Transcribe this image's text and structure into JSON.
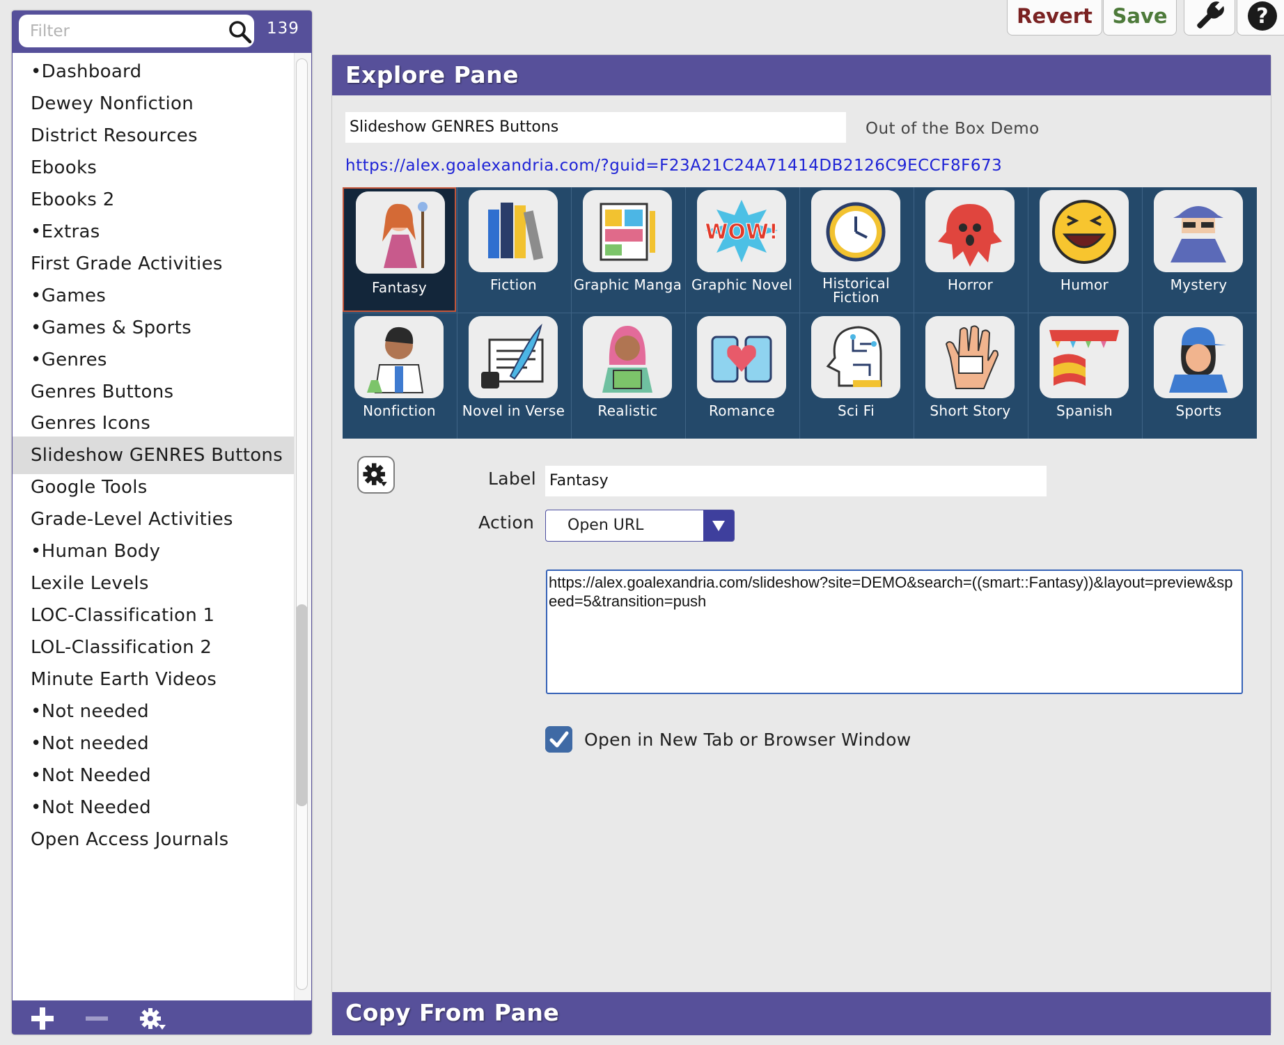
{
  "sidebar": {
    "filter_placeholder": "Filter",
    "count": "139",
    "items": [
      {
        "label": "•Dashboard"
      },
      {
        "label": "Dewey Nonfiction"
      },
      {
        "label": "District Resources"
      },
      {
        "label": "Ebooks"
      },
      {
        "label": "Ebooks 2"
      },
      {
        "label": "•Extras"
      },
      {
        "label": "First Grade Activities"
      },
      {
        "label": "•Games"
      },
      {
        "label": "•Games & Sports"
      },
      {
        "label": "•Genres"
      },
      {
        "label": "Genres Buttons"
      },
      {
        "label": "Genres Icons"
      },
      {
        "label": "Slideshow GENRES Buttons",
        "selected": true
      },
      {
        "label": "Google Tools"
      },
      {
        "label": "Grade-Level Activities"
      },
      {
        "label": "•Human Body"
      },
      {
        "label": "Lexile Levels"
      },
      {
        "label": "LOC-Classification 1"
      },
      {
        "label": "LOL-Classification 2"
      },
      {
        "label": "Minute Earth Videos"
      },
      {
        "label": "•Not needed"
      },
      {
        "label": "•Not needed"
      },
      {
        "label": "•Not Needed"
      },
      {
        "label": "•Not Needed"
      },
      {
        "label": "Open Access Journals"
      }
    ],
    "footer_icons": [
      "plus-icon",
      "minus-icon",
      "gear-menu-icon"
    ]
  },
  "toolbar": {
    "revert_label": "Revert",
    "save_label": "Save",
    "revert_color": "#7a2222",
    "save_color": "#4d7a3a",
    "tools_icon": "wrench-icon",
    "help_icon": "question-icon"
  },
  "explore": {
    "title": "Explore Pane",
    "pane_name": "Slideshow GENRES Buttons",
    "site": "Out of the Box Demo",
    "url": "https://alex.goalexandria.com/?guid=F23A21C24A71414DB2126C9ECCF8F673",
    "genres": [
      {
        "label": "Fantasy",
        "icon": "fantasy-icon",
        "selected": true
      },
      {
        "label": "Fiction",
        "icon": "fiction-icon"
      },
      {
        "label": "Graphic Manga",
        "icon": "graphic-manga-icon"
      },
      {
        "label": "Graphic Novel",
        "icon": "graphic-novel-icon"
      },
      {
        "label": "Historical Fiction",
        "icon": "historical-fiction-icon"
      },
      {
        "label": "Horror",
        "icon": "horror-icon"
      },
      {
        "label": "Humor",
        "icon": "humor-icon"
      },
      {
        "label": "Mystery",
        "icon": "mystery-icon"
      },
      {
        "label": "Nonfiction",
        "icon": "nonfiction-icon"
      },
      {
        "label": "Novel in Verse",
        "icon": "novel-in-verse-icon"
      },
      {
        "label": "Realistic",
        "icon": "realistic-icon"
      },
      {
        "label": "Romance",
        "icon": "romance-icon"
      },
      {
        "label": "Sci Fi",
        "icon": "sci-fi-icon"
      },
      {
        "label": "Short Story",
        "icon": "short-story-icon"
      },
      {
        "label": "Spanish",
        "icon": "spanish-icon"
      },
      {
        "label": "Sports",
        "icon": "sports-icon"
      }
    ],
    "form": {
      "label_caption": "Label",
      "label_value": "Fantasy",
      "action_caption": "Action",
      "action_value": "Open URL",
      "url_value": "https://alex.goalexandria.com/slideshow?site=DEMO&search=((smart::Fantasy))&layout=preview&speed=5&transition=push",
      "new_tab_label": "Open in New Tab or Browser Window",
      "new_tab_checked": true
    }
  },
  "copy_pane": {
    "title": "Copy From Pane"
  }
}
